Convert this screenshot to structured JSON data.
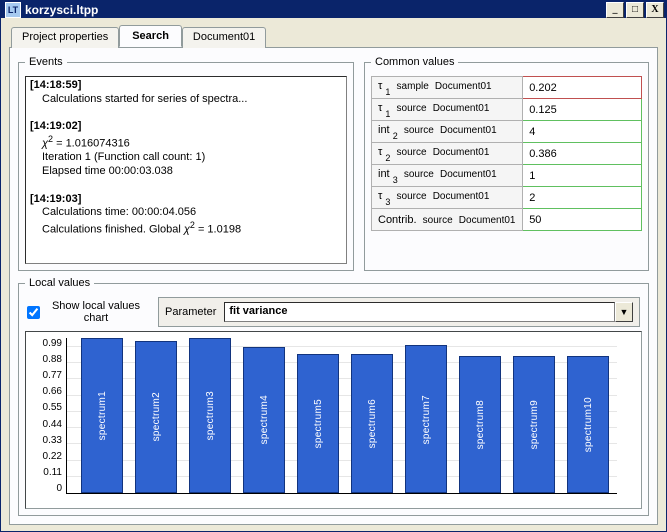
{
  "window": {
    "title": "korzysci.ltpp"
  },
  "titlebar_controls": {
    "min": "_",
    "max": "□",
    "close": "X"
  },
  "tabs": [
    {
      "id": "project",
      "label": "Project properties",
      "active": false
    },
    {
      "id": "search",
      "label": "Search",
      "active": true
    },
    {
      "id": "doc01",
      "label": "Document01",
      "active": false
    }
  ],
  "events": {
    "legend": "Events",
    "entries": [
      {
        "ts": "[14:18:59]",
        "lines": [
          "Calculations started for series of spectra..."
        ]
      },
      {
        "ts": "[14:19:02]",
        "lines": [
          "χ² = 1.016074316",
          "Iteration 1 (Function call count: 1)",
          "Elapsed time 00:00:03.038"
        ]
      },
      {
        "ts": "[14:19:03]",
        "lines": [
          "Calculations time: 00:00:04.056",
          "Calculations finished. Global  χ² = 1.0198"
        ]
      }
    ]
  },
  "common": {
    "legend": "Common values",
    "rows": [
      {
        "sym": "τ",
        "idx": "1",
        "kind": "sample",
        "doc": "Document01",
        "val": "0.202",
        "cls": "red"
      },
      {
        "sym": "τ",
        "idx": "1",
        "kind": "source",
        "doc": "Document01",
        "val": "0.125",
        "cls": ""
      },
      {
        "sym": "int",
        "idx": "2",
        "kind": "source",
        "doc": "Document01",
        "val": "4",
        "cls": ""
      },
      {
        "sym": "τ",
        "idx": "2",
        "kind": "source",
        "doc": "Document01",
        "val": "0.386",
        "cls": ""
      },
      {
        "sym": "int",
        "idx": "3",
        "kind": "source",
        "doc": "Document01",
        "val": "1",
        "cls": ""
      },
      {
        "sym": "τ",
        "idx": "3",
        "kind": "source",
        "doc": "Document01",
        "val": "2",
        "cls": ""
      },
      {
        "sym": "Contrib.",
        "idx": "",
        "kind": "source",
        "doc": "Document01",
        "val": "50",
        "cls": ""
      }
    ]
  },
  "local": {
    "legend": "Local values",
    "show_chart_label": "Show local values chart",
    "show_chart_checked": true,
    "param_label": "Parameter",
    "param_value": "fit variance"
  },
  "chart_data": {
    "type": "bar",
    "title": "",
    "xlabel": "",
    "ylabel": "",
    "ylim": [
      0,
      1.05
    ],
    "y_ticks": [
      0,
      0.11,
      0.22,
      0.33,
      0.44,
      0.55,
      0.66,
      0.77,
      0.88,
      0.99
    ],
    "categories": [
      "spectrum1",
      "spectrum2",
      "spectrum3",
      "spectrum4",
      "spectrum5",
      "spectrum6",
      "spectrum7",
      "spectrum8",
      "spectrum9",
      "spectrum10"
    ],
    "values": [
      1.05,
      1.03,
      1.05,
      0.99,
      0.94,
      0.94,
      1.0,
      0.93,
      0.93,
      0.93
    ]
  }
}
